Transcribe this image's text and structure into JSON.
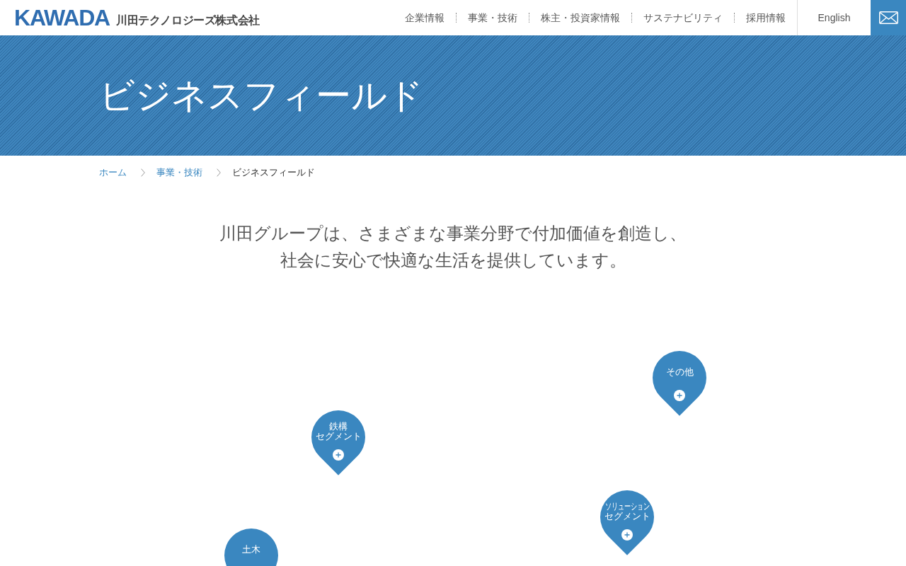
{
  "header": {
    "logo": {
      "wordmark": "KAWADA",
      "company_name": "川田テクノロジーズ株式会社"
    },
    "nav": [
      "企業情報",
      "事業・技術",
      "株主・投資家情報",
      "サステナビリティ",
      "採用情報"
    ],
    "language_link": "English"
  },
  "hero": {
    "title": "ビジネスフィールド"
  },
  "breadcrumb": [
    {
      "label": "ホーム",
      "current": false
    },
    {
      "label": "事業・技術",
      "current": false
    },
    {
      "label": "ビジネスフィールド",
      "current": true
    }
  ],
  "lead": "川田グループは、さまざまな事業分野で付加価値を創造し、社会に安心で快適な生活を提供しています。",
  "map_pins": [
    {
      "label_lines": [
        "その他"
      ]
    },
    {
      "label_lines": [
        "鉄構",
        "セグメント"
      ]
    },
    {
      "label_lines": [
        "ソリューション",
        "セグメント"
      ]
    },
    {
      "label_lines": [
        "土木"
      ]
    }
  ]
}
